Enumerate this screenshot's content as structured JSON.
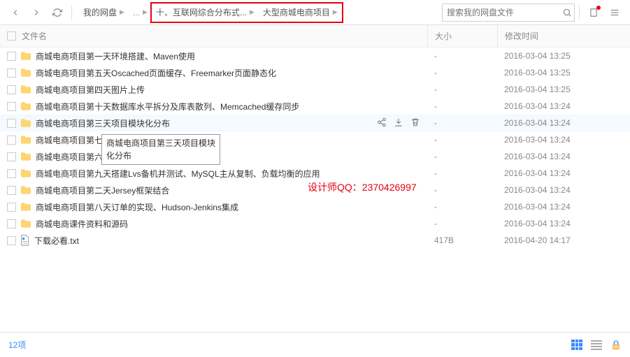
{
  "breadcrumb": {
    "root": "我的网盘",
    "part1": "十、互联网综合分布式...",
    "part2": "大型商城电商项目"
  },
  "search": {
    "placeholder": "搜索我的网盘文件"
  },
  "columns": {
    "name": "文件名",
    "size": "大小",
    "time": "修改时间"
  },
  "files": [
    {
      "name": "商城电商项目第一天环境搭建、Maven使用",
      "type": "folder",
      "size": "-",
      "time": "2016-03-04 13:25"
    },
    {
      "name": "商城电商项目第五天Oscached页面缓存、Freemarker页面静态化",
      "type": "folder",
      "size": "-",
      "time": "2016-03-04 13:25"
    },
    {
      "name": "商城电商项目第四天图片上传",
      "type": "folder",
      "size": "-",
      "time": "2016-03-04 13:25"
    },
    {
      "name": "商城电商项目第十天数据库水平拆分及库表散列、Memcached缓存同步",
      "type": "folder",
      "size": "-",
      "time": "2016-03-04 13:24"
    },
    {
      "name": "商城电商项目第三天项目模块化分布",
      "type": "folder",
      "size": "-",
      "time": "2016-03-04 13:24",
      "highlight": true,
      "actions": true
    },
    {
      "name": "商城电商项目第七天",
      "type": "folder",
      "size": "-",
      "time": "2016-03-04 13:24"
    },
    {
      "name": "商城电商项目第六天",
      "type": "folder",
      "size": "-",
      "time": "2016-03-04 13:24"
    },
    {
      "name": "商城电商项目第九天搭建Lvs备机并测试、MySQL主从复制、负载均衡的应用",
      "type": "folder",
      "size": "-",
      "time": "2016-03-04 13:24"
    },
    {
      "name": "商城电商项目第二天Jersey框架结合",
      "type": "folder",
      "size": "-",
      "time": "2016-03-04 13:24"
    },
    {
      "name": "商城电商项目第八天订单的实现、Hudson-Jenkins集成",
      "type": "folder",
      "size": "-",
      "time": "2016-03-04 13:24"
    },
    {
      "name": "商城电商课件资料和源码",
      "type": "folder",
      "size": "-",
      "time": "2016-03-04 13:24"
    },
    {
      "name": "下载必看.txt",
      "type": "file",
      "size": "417B",
      "time": "2016-04-20 14:17"
    }
  ],
  "tooltip": "商城电商项目第三天项目模块化分布",
  "watermark": "设计师QQ：2370426997",
  "footer": {
    "count": "12项"
  }
}
